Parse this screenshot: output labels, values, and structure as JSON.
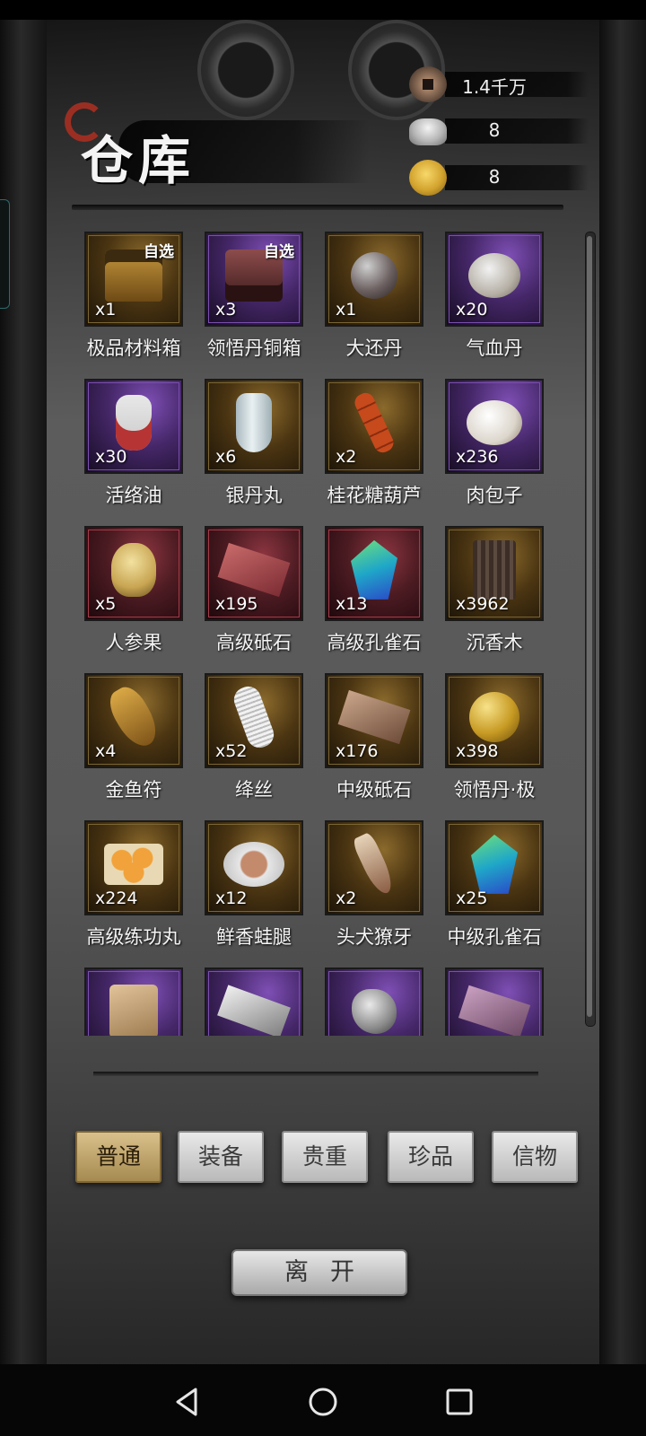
{
  "title": "仓库",
  "currencies": [
    {
      "icon": "copper-coin-icon",
      "value": "1.4千万"
    },
    {
      "icon": "silver-ingot-icon",
      "value": "8"
    },
    {
      "icon": "gold-coin-icon",
      "value": "8"
    }
  ],
  "items": [
    {
      "name": "极品材料箱",
      "qty": "x1",
      "tag": "自选",
      "rarity": "gold",
      "icon": "material-chest-icon",
      "art": "chest"
    },
    {
      "name": "领悟丹铜箱",
      "qty": "x3",
      "tag": "自选",
      "rarity": "purple",
      "icon": "pill-chest-icon",
      "art": "chest-red"
    },
    {
      "name": "大还丹",
      "qty": "x1",
      "tag": "",
      "rarity": "gold",
      "icon": "pill-ball-icon",
      "art": "ball"
    },
    {
      "name": "气血丹",
      "qty": "x20",
      "tag": "",
      "rarity": "purple",
      "icon": "pill-plate-icon",
      "art": "pill-plate"
    },
    {
      "name": "活络油",
      "qty": "x30",
      "tag": "",
      "rarity": "purple",
      "icon": "oil-bottle-icon",
      "art": "bottle"
    },
    {
      "name": "银丹丸",
      "qty": "x6",
      "tag": "",
      "rarity": "gold",
      "icon": "porcelain-vase-icon",
      "art": "vase"
    },
    {
      "name": "桂花糖葫芦",
      "qty": "x2",
      "tag": "",
      "rarity": "gold",
      "icon": "candied-haws-icon",
      "art": "skewer"
    },
    {
      "name": "肉包子",
      "qty": "x236",
      "tag": "",
      "rarity": "purple",
      "icon": "steamed-bun-icon",
      "art": "bun"
    },
    {
      "name": "人参果",
      "qty": "x5",
      "tag": "",
      "rarity": "red",
      "icon": "ginseng-fruit-icon",
      "art": "ginseng"
    },
    {
      "name": "高级砥石",
      "qty": "x195",
      "tag": "",
      "rarity": "red",
      "icon": "whetstone-icon",
      "art": "brick-red"
    },
    {
      "name": "高级孔雀石",
      "qty": "x13",
      "tag": "",
      "rarity": "red",
      "icon": "malachite-icon",
      "art": "gem"
    },
    {
      "name": "沉香木",
      "qty": "x3962",
      "tag": "",
      "rarity": "gold",
      "icon": "agarwood-icon",
      "art": "wood"
    },
    {
      "name": "金鱼符",
      "qty": "x4",
      "tag": "",
      "rarity": "gold",
      "icon": "goldfish-talisman-icon",
      "art": "fish"
    },
    {
      "name": "绛丝",
      "qty": "x52",
      "tag": "",
      "rarity": "gold",
      "icon": "silk-spool-icon",
      "art": "thread"
    },
    {
      "name": "中级砥石",
      "qty": "x176",
      "tag": "",
      "rarity": "gold",
      "icon": "whetstone-icon",
      "art": "brick-tan"
    },
    {
      "name": "领悟丹·极",
      "qty": "x398",
      "tag": "",
      "rarity": "gold",
      "icon": "golden-orb-icon",
      "art": "gold-orb"
    },
    {
      "name": "高级练功丸",
      "qty": "x224",
      "tag": "",
      "rarity": "gold",
      "icon": "training-pills-icon",
      "art": "orange-plate"
    },
    {
      "name": "鲜香蛙腿",
      "qty": "x12",
      "tag": "",
      "rarity": "gold",
      "icon": "frog-legs-icon",
      "art": "frog-plate"
    },
    {
      "name": "头犬獠牙",
      "qty": "x2",
      "tag": "",
      "rarity": "gold",
      "icon": "fang-icon",
      "art": "fang"
    },
    {
      "name": "中级孔雀石",
      "qty": "x25",
      "tag": "",
      "rarity": "gold",
      "icon": "malachite-icon",
      "art": "gem"
    },
    {
      "name": "",
      "qty": "",
      "tag": "",
      "rarity": "purple",
      "icon": "token-icon",
      "art": "token"
    },
    {
      "name": "",
      "qty": "",
      "tag": "",
      "rarity": "purple",
      "icon": "silver-bar-icon",
      "art": "silver-bar"
    },
    {
      "name": "",
      "qty": "",
      "tag": "",
      "rarity": "purple",
      "icon": "rock-icon",
      "art": "rock"
    },
    {
      "name": "",
      "qty": "",
      "tag": "",
      "rarity": "purple",
      "icon": "mauve-brick-icon",
      "art": "brick-mauve"
    }
  ],
  "tabs": [
    {
      "label": "普通",
      "active": true
    },
    {
      "label": "装备",
      "active": false
    },
    {
      "label": "贵重",
      "active": false
    },
    {
      "label": "珍品",
      "active": false
    },
    {
      "label": "信物",
      "active": false
    }
  ],
  "leave_label": "离开",
  "system_nav": [
    "back-icon",
    "home-icon",
    "recent-apps-icon"
  ]
}
